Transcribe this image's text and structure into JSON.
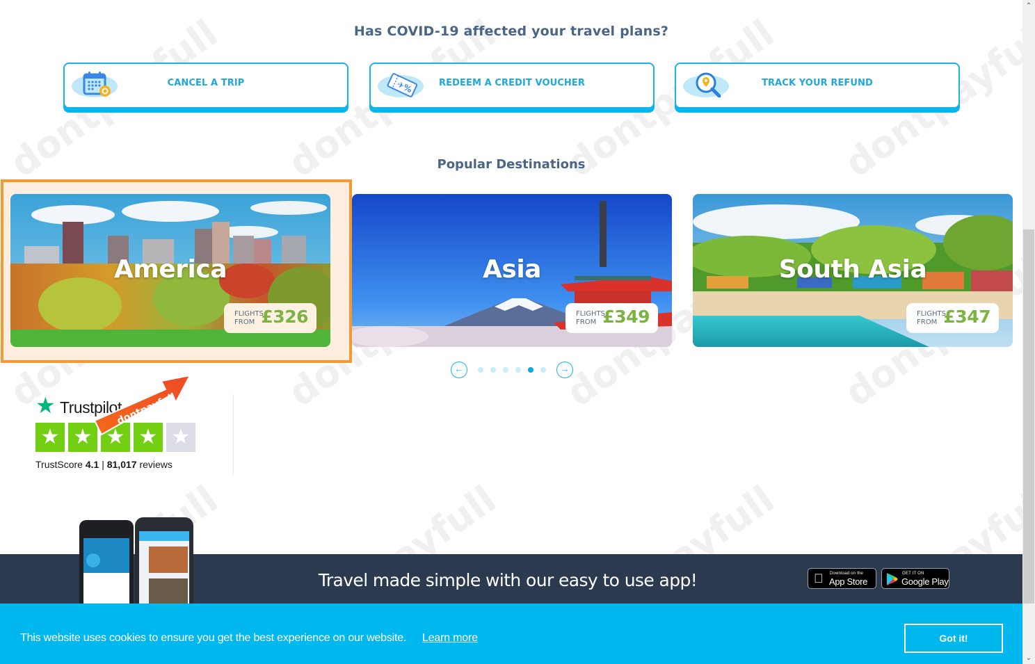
{
  "covid": {
    "title": "Has COVID-19 affected your travel plans?",
    "actions": [
      {
        "label": "CANCEL A TRIP",
        "icon": "calendar-settings-icon"
      },
      {
        "label": "REDEEM A CREDIT VOUCHER",
        "icon": "ticket-voucher-icon"
      },
      {
        "label": "TRACK YOUR REFUND",
        "icon": "magnifier-location-icon"
      }
    ]
  },
  "popular": {
    "title": "Popular Destinations",
    "flights_from_line1": "FLIGHTS",
    "flights_from_line2": "FROM",
    "destinations": [
      {
        "name": "America",
        "price": "£326",
        "highlighted": true
      },
      {
        "name": "Asia",
        "price": "£349",
        "highlighted": false
      },
      {
        "name": "South Asia",
        "price": "£347",
        "highlighted": false
      }
    ],
    "carousel": {
      "prev_icon": "←",
      "next_icon": "→",
      "dot_count": 6,
      "active_dot": 5
    }
  },
  "trustpilot": {
    "brand": "Trustpilot",
    "star_icon": "★",
    "rating_stars": 4,
    "total_stars": 5,
    "score_label": "TrustScore",
    "score": "4.1",
    "separator": "|",
    "reviews_count": "81,017",
    "reviews_label": "reviews"
  },
  "watermark": {
    "text": "dontpayfull",
    "arrow_text": "dontpayfull"
  },
  "app_banner": {
    "text": "Travel made simple with our easy to use app!",
    "app_store_small": "Download on the",
    "app_store_big": "App Store",
    "google_small": "GET IT ON",
    "google_big": "Google Play"
  },
  "cookie": {
    "message": "This website uses cookies to ensure you get the best experience on our website.",
    "learn_more": "Learn more",
    "accept": "Got it!"
  },
  "scrollbar": {
    "up_icon": "⌃",
    "down_icon": "⌄"
  },
  "colors": {
    "accent": "#15b3e8",
    "heading": "#4a6585",
    "price": "#7cb342",
    "highlight": "#f39a34",
    "banner": "#2c3a50",
    "cookie_bar": "#00b8ee",
    "trustpilot_green": "#73cf11"
  }
}
